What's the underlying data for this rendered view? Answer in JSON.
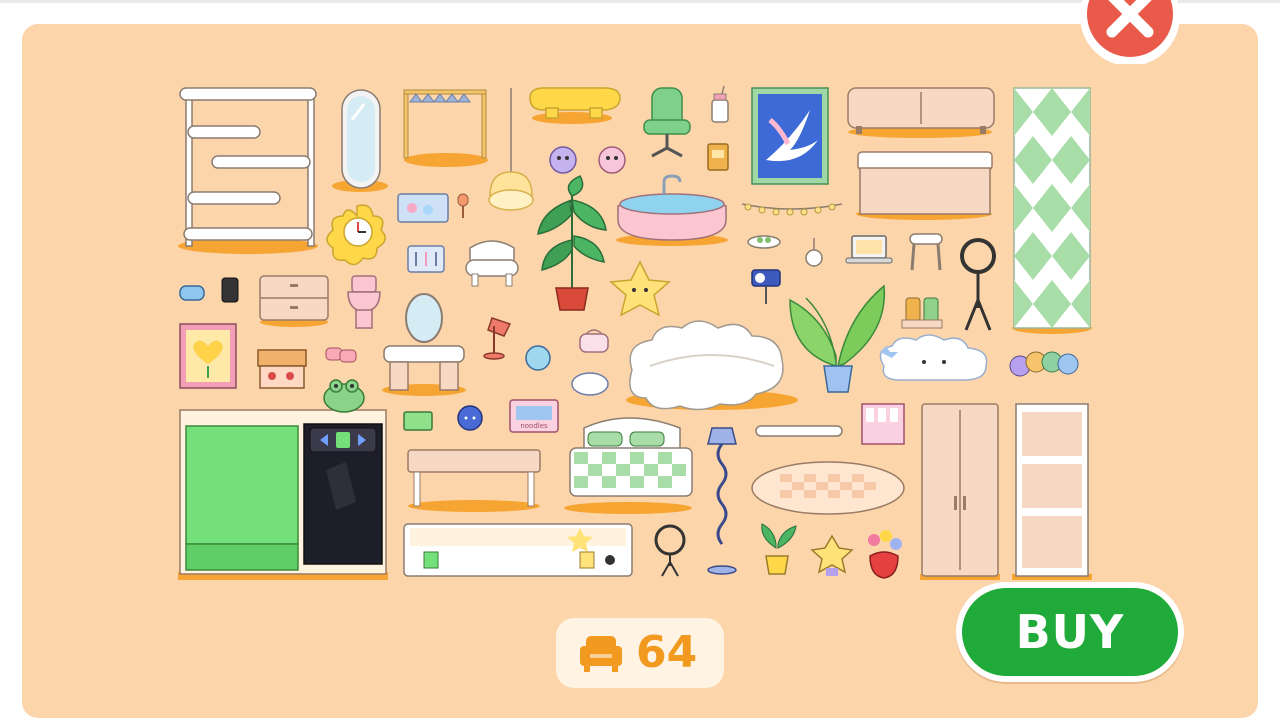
{
  "screen": "furniture-pack-purchase",
  "buy_button": {
    "label": "BUY",
    "color": "#1faa3a"
  },
  "close_button": {
    "icon": "close-icon",
    "color": "#ea5a4b"
  },
  "item_count": {
    "icon": "armchair-icon",
    "value": "64",
    "color": "#f29a1f"
  },
  "colors": {
    "panel": "#fdd5ab",
    "accent_orange": "#f6a532",
    "green": "#73e07a"
  },
  "tv_cabinet_sticker": "noodles",
  "items": [
    "shelf-unit-icon",
    "floor-mirror-icon",
    "clothes-rack-icon",
    "pendant-lamp-icon",
    "cloud-coffee-table-icon",
    "gaming-chair-icon",
    "tumbler-icon",
    "framed-bird-art-icon",
    "low-sideboard-icon",
    "checkered-curtain-icon",
    "flower-wall-clock-icon",
    "plush-toy-icon",
    "bathtub-icon",
    "string-lights-icon",
    "storage-bench-icon",
    "potted-plant-icon",
    "star-wall-light-icon",
    "laptop-icon",
    "stool-icon",
    "ring-light-tripod-icon",
    "nightstand-icon",
    "toilet-icon",
    "vanity-table-icon",
    "desk-lamp-icon",
    "cloud-sofa-icon",
    "tall-plant-icon",
    "cloud-rug-icon",
    "caterpillar-plush-icon",
    "framed-heart-art-icon",
    "toy-chest-icon",
    "aquarium-cabinet-icon",
    "frog-plush-icon",
    "coffee-table-icon",
    "green-checkered-bed-icon",
    "wavy-floor-lamp-icon",
    "wall-shelf-icon",
    "round-checkered-rug-icon",
    "wardrobe-icon",
    "bookcase-icon",
    "star-tv-bench-icon",
    "selfie-ring-light-icon",
    "small-plant-icon",
    "star-plush-icon",
    "strawberry-flower-pot-icon",
    "camera-icon"
  ]
}
